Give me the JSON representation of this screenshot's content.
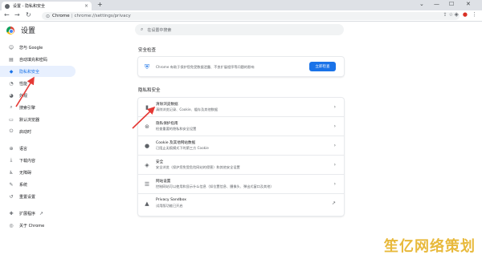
{
  "browser": {
    "tab_title": "设置 - 隐私和安全",
    "tab_close": "×",
    "new_tab": "+",
    "window_controls": [
      "⌄",
      "—",
      "☐",
      "✕"
    ],
    "omnibox_brand": "Chrome",
    "omnibox_sep": "|",
    "omnibox_url": "chrome://settings/privacy"
  },
  "settings": {
    "heading": "设置",
    "search_placeholder": "在设置中搜索"
  },
  "sidebar": {
    "items": [
      {
        "label": "您与 Google",
        "icon": "person-icon"
      },
      {
        "label": "自动填充和密码",
        "icon": "clipboard-icon"
      },
      {
        "label": "隐私和安全",
        "icon": "shield-icon",
        "active": true
      },
      {
        "label": "性能",
        "icon": "speedometer-icon"
      },
      {
        "label": "外观",
        "icon": "palette-icon"
      },
      {
        "label": "搜索引擎",
        "icon": "search-icon"
      },
      {
        "label": "默认浏览器",
        "icon": "browser-icon"
      },
      {
        "label": "启动时",
        "icon": "power-icon"
      },
      {
        "label": "语言",
        "icon": "globe-icon"
      },
      {
        "label": "下载内容",
        "icon": "download-icon"
      },
      {
        "label": "无障碍",
        "icon": "accessibility-icon"
      },
      {
        "label": "系统",
        "icon": "wrench-icon"
      },
      {
        "label": "重置设置",
        "icon": "reset-icon"
      },
      {
        "label": "扩展程序",
        "icon": "puzzle-icon"
      },
      {
        "label": "关于 Chrome",
        "icon": "chrome-icon"
      }
    ]
  },
  "safety_check": {
    "title": "安全检查",
    "description": "Chrome 有助于保护您免受数据泄露、不良扩展程序等问题的影响",
    "button": "立即检查"
  },
  "privacy": {
    "title": "隐私和安全",
    "rows": [
      {
        "title": "清除浏览数据",
        "subtitle": "清除浏览记录、Cookie、缓存及其他数据",
        "icon": "trash-icon"
      },
      {
        "title": "隐私保护指南",
        "subtitle": "检查重要的隐私和安全设置",
        "icon": "guide-icon"
      },
      {
        "title": "Cookie 及其他网站数据",
        "subtitle": "已阻止无痕模式下的第三方 Cookie",
        "icon": "cookie-icon"
      },
      {
        "title": "安全",
        "subtitle": "安全浏览（保护您免受危险网站的侵害）和其他安全设置",
        "icon": "shield-icon"
      },
      {
        "title": "网站设置",
        "subtitle": "控制网站可以使用和显示什么信息（如位置信息、摄像头、弹出式窗口及其他）",
        "icon": "sliders-icon"
      },
      {
        "title": "Privacy Sandbox",
        "subtitle": "试用版功能已开启",
        "icon": "flask-icon"
      }
    ]
  },
  "watermark": "笙亿网络策划",
  "colors": {
    "accent": "#1a73e8",
    "annotation": "#e53935",
    "watermark": "#e8b93b"
  }
}
